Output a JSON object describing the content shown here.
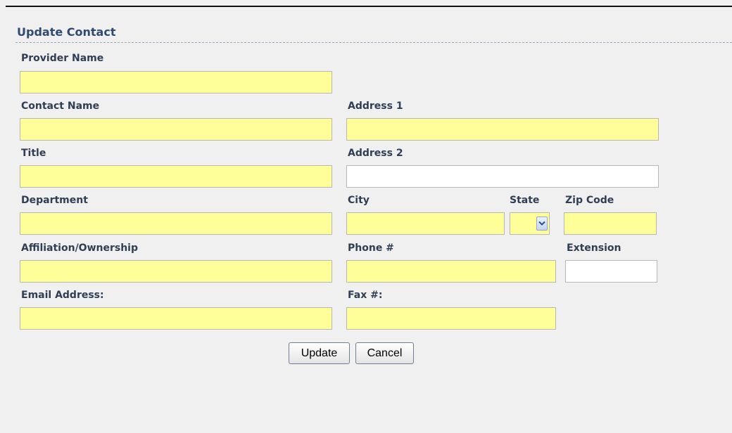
{
  "form": {
    "title": "Update Contact",
    "update_label": "Update",
    "cancel_label": "Cancel"
  },
  "fields": {
    "provider_name": {
      "label": "Provider Name",
      "value": ""
    },
    "contact_name": {
      "label": "Contact Name",
      "value": ""
    },
    "address1": {
      "label": "Address 1",
      "value": ""
    },
    "title": {
      "label": "Title",
      "value": ""
    },
    "address2": {
      "label": "Address 2",
      "value": ""
    },
    "department": {
      "label": "Department",
      "value": ""
    },
    "city": {
      "label": "City",
      "value": ""
    },
    "state": {
      "label": "State",
      "value": ""
    },
    "zip": {
      "label": "Zip Code",
      "value": ""
    },
    "affiliation": {
      "label": "Affiliation/Ownership",
      "value": ""
    },
    "phone": {
      "label": "Phone #",
      "value": ""
    },
    "extension": {
      "label": "Extension",
      "value": ""
    },
    "email": {
      "label": "Email Address:",
      "value": ""
    },
    "fax": {
      "label": "Fax #:",
      "value": ""
    }
  },
  "colors": {
    "required_field_bg": "#ffff99",
    "optional_field_bg": "#ffffff",
    "label_color": "#2f3e52",
    "title_color": "#2f4a6e",
    "page_bg": "#f0f0f0"
  },
  "icons": {
    "state_dropdown": "chevron-down-icon"
  }
}
